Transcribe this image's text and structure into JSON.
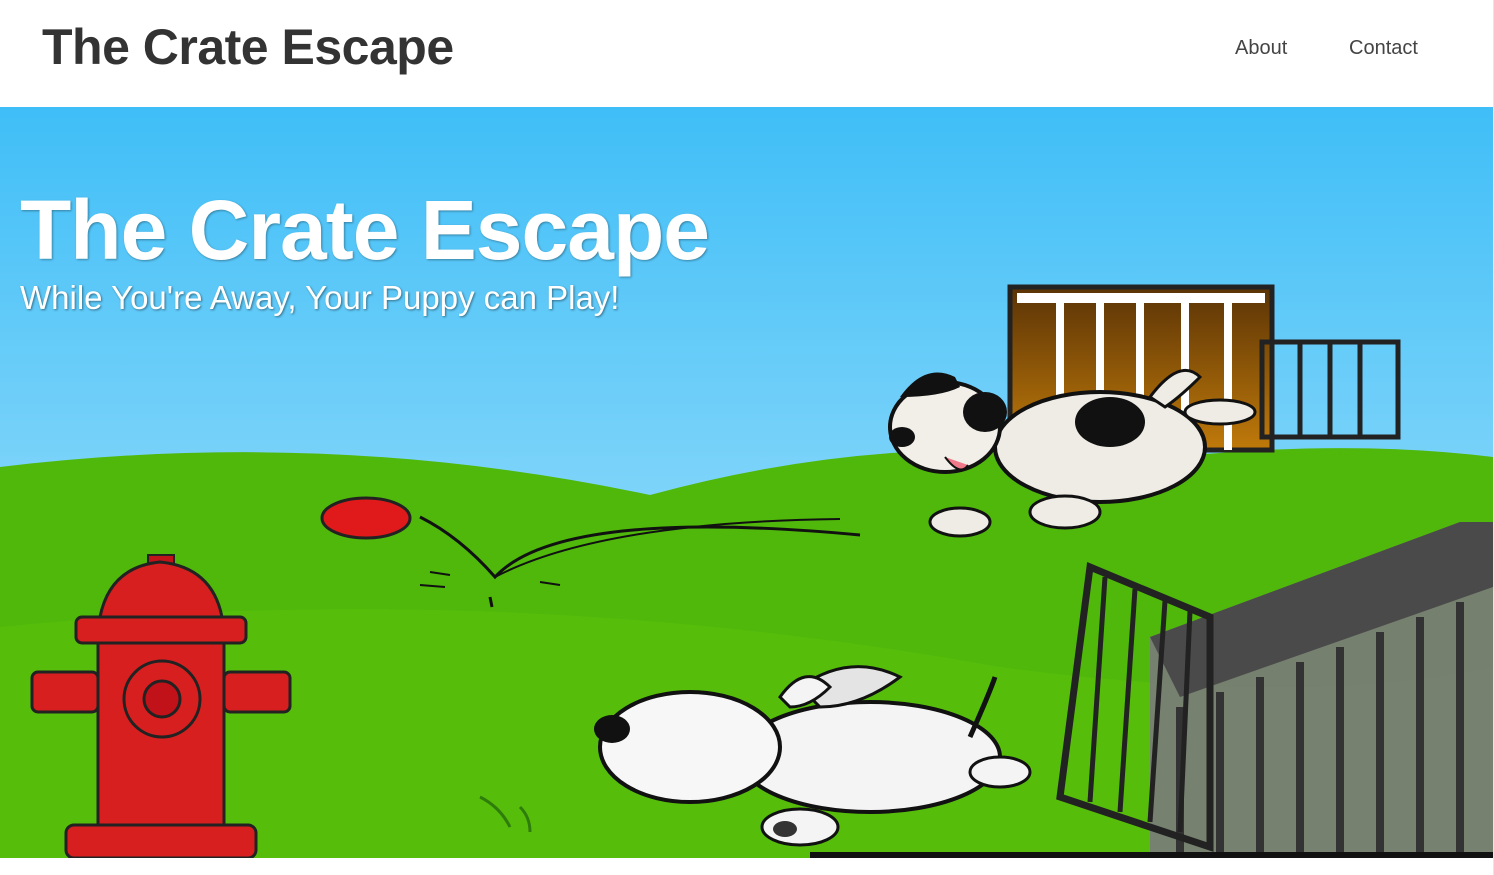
{
  "header": {
    "brand": "The Crate Escape",
    "nav": [
      {
        "label": "About"
      },
      {
        "label": "Contact"
      }
    ]
  },
  "hero": {
    "title": "The Crate Escape",
    "subtitle": "While You're Away, Your Puppy can Play!",
    "colors": {
      "sky_top": "#3fbef7",
      "sky_bottom": "#a8e2fb",
      "grass": "#4fb80a",
      "hydrant": "#d81f1f",
      "ball": "#e01a1a",
      "crate_wood": "#9a5a0a",
      "cage": "#3d3d3d"
    },
    "illustration_elements": [
      "fire-hydrant",
      "red-ball",
      "escaping-dog",
      "running-dog",
      "wooden-crate",
      "metal-cage"
    ]
  }
}
